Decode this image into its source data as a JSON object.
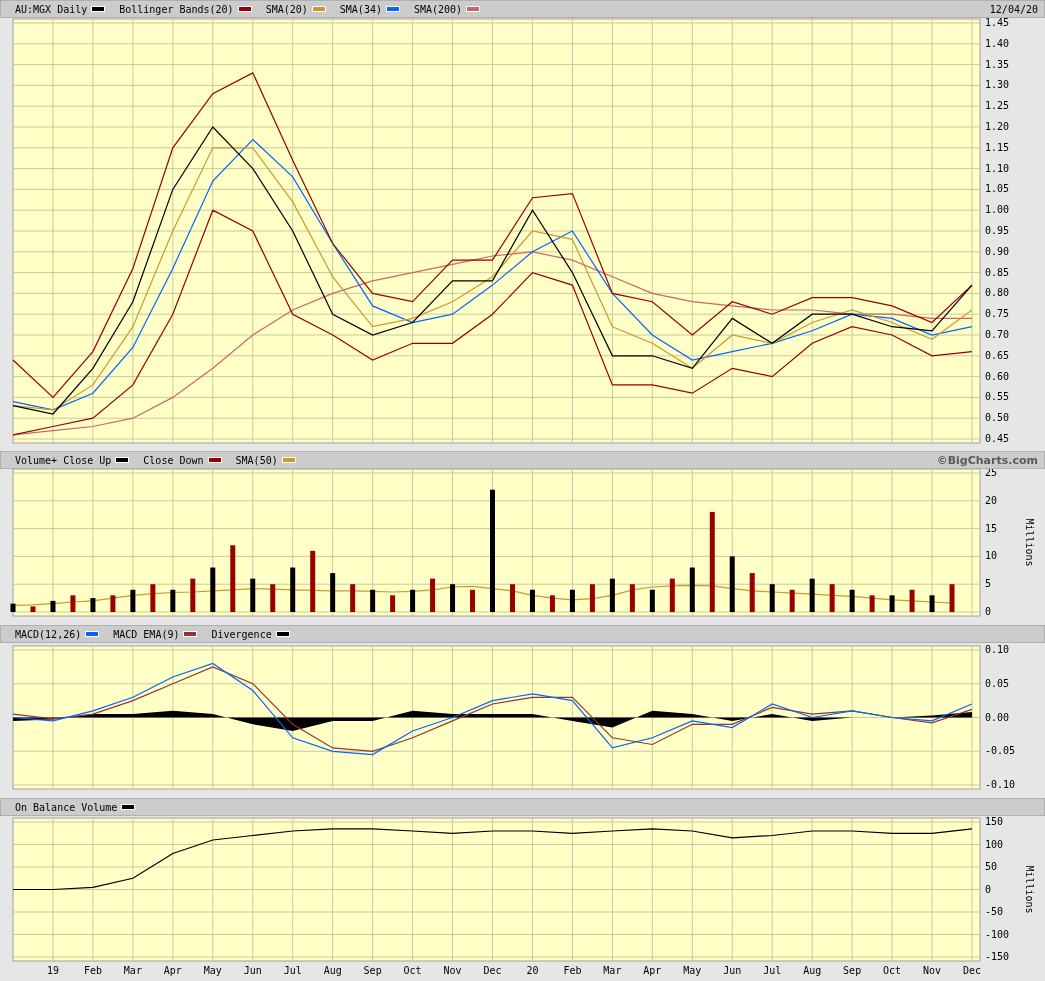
{
  "date": "12/04/20",
  "price_panel": {
    "chart_data": {
      "type": "line",
      "grid": true,
      "categories": [
        null,
        null,
        null,
        null,
        null,
        null,
        null,
        null,
        null,
        null,
        null,
        null,
        null,
        null,
        null,
        null,
        null,
        null,
        null,
        null,
        null,
        null,
        null,
        null,
        null
      ],
      "ylim": [
        0.45,
        1.45
      ],
      "yticks": [
        {
          "value": 0.45,
          "label": "0.45"
        },
        {
          "value": 0.5,
          "label": "0.50"
        },
        {
          "value": 0.55,
          "label": "0.55"
        },
        {
          "value": 0.6,
          "label": "0.60"
        },
        {
          "value": 0.65,
          "label": "0.65"
        },
        {
          "value": 0.7,
          "label": "0.70"
        },
        {
          "value": 0.75,
          "label": "0.75"
        },
        {
          "value": 0.8,
          "label": "0.80"
        },
        {
          "value": 0.85,
          "label": "0.85"
        },
        {
          "value": 0.9,
          "label": "0.90"
        },
        {
          "value": 0.95,
          "label": "0.95"
        },
        {
          "value": 1.0,
          "label": "1.00"
        },
        {
          "value": 1.05,
          "label": "1.05"
        },
        {
          "value": 1.1,
          "label": "1.10"
        },
        {
          "value": 1.15,
          "label": "1.15"
        },
        {
          "value": 1.2,
          "label": "1.20"
        },
        {
          "value": 1.25,
          "label": "1.25"
        },
        {
          "value": 1.3,
          "label": "1.30"
        },
        {
          "value": 1.35,
          "label": "1.35"
        },
        {
          "value": 1.4,
          "label": "1.40"
        },
        {
          "value": 1.45,
          "label": "1.45"
        }
      ],
      "series": [
        {
          "name": "AU:MGX Daily",
          "color": "#000000",
          "values": [
            0.53,
            0.51,
            0.62,
            0.78,
            1.05,
            1.2,
            1.1,
            0.95,
            0.75,
            0.7,
            0.73,
            0.83,
            0.83,
            1.0,
            0.85,
            0.65,
            0.65,
            0.62,
            0.74,
            0.68,
            0.75,
            0.75,
            0.72,
            0.71,
            0.82
          ]
        },
        {
          "name": "Bollinger Bands(20)",
          "color": "#990000",
          "values": [
            0.64,
            0.55,
            0.66,
            0.86,
            1.15,
            1.28,
            1.33,
            1.12,
            0.92,
            0.8,
            0.78,
            0.88,
            0.88,
            1.03,
            1.04,
            0.8,
            0.78,
            0.7,
            0.78,
            0.75,
            0.79,
            0.79,
            0.77,
            0.73,
            0.82
          ]
        },
        {
          "color": "#990000",
          "values": [
            0.46,
            0.48,
            0.5,
            0.58,
            0.75,
            1.0,
            0.95,
            0.75,
            0.7,
            0.64,
            0.68,
            0.68,
            0.75,
            0.85,
            0.82,
            0.58,
            0.58,
            0.56,
            0.62,
            0.6,
            0.68,
            0.72,
            0.7,
            0.65,
            0.66
          ]
        },
        {
          "name": "SMA(20)",
          "color": "#cc9933",
          "values": [
            0.53,
            0.52,
            0.58,
            0.72,
            0.95,
            1.15,
            1.15,
            1.02,
            0.84,
            0.72,
            0.74,
            0.78,
            0.84,
            0.95,
            0.93,
            0.72,
            0.68,
            0.62,
            0.7,
            0.68,
            0.73,
            0.76,
            0.73,
            0.69,
            0.76
          ]
        },
        {
          "name": "SMA(34)",
          "color": "#0066ff",
          "values": [
            0.54,
            0.52,
            0.56,
            0.67,
            0.86,
            1.07,
            1.17,
            1.08,
            0.92,
            0.77,
            0.73,
            0.75,
            0.82,
            0.9,
            0.95,
            0.8,
            0.7,
            0.64,
            0.66,
            0.68,
            0.71,
            0.75,
            0.74,
            0.7,
            0.72
          ]
        },
        {
          "name": "SMA(200)",
          "color": "#cc6666",
          "values": [
            0.46,
            0.47,
            0.48,
            0.5,
            0.55,
            0.62,
            0.7,
            0.76,
            0.8,
            0.83,
            0.85,
            0.87,
            0.89,
            0.9,
            0.88,
            0.84,
            0.8,
            0.78,
            0.77,
            0.76,
            0.76,
            0.75,
            0.75,
            0.74,
            0.74
          ]
        }
      ]
    }
  },
  "volume_panel": {
    "credit": "©BigCharts.com",
    "chart_data": {
      "type": "bar",
      "stacked": true,
      "grid": true,
      "categories": [
        null,
        null,
        null,
        null,
        null,
        null,
        null,
        null,
        null,
        null,
        null,
        null,
        null,
        null,
        null,
        null,
        null,
        null,
        null,
        null,
        null,
        null,
        null,
        null,
        null,
        null,
        null,
        null,
        null,
        null,
        null,
        null,
        null,
        null,
        null,
        null,
        null,
        null,
        null,
        null,
        null,
        null,
        null,
        null,
        null,
        null,
        null,
        null
      ],
      "ylim": [
        0,
        25
      ],
      "ylabel": "Millions",
      "yticks": [
        0,
        5,
        10,
        15,
        20,
        25
      ],
      "series": [
        {
          "name": "Volume+ Close Up",
          "color": "#000000",
          "values": [
            1.5,
            null,
            2,
            null,
            2.5,
            null,
            4,
            null,
            4,
            null,
            8,
            null,
            6,
            null,
            8,
            null,
            7,
            null,
            4,
            null,
            4,
            null,
            5,
            null,
            22,
            null,
            4,
            null,
            4,
            null,
            6,
            null,
            4,
            null,
            8,
            null,
            10,
            null,
            5,
            null,
            6,
            null,
            4,
            null,
            3,
            null,
            3,
            null
          ]
        },
        {
          "name": "Close Down",
          "color": "#990000",
          "values": [
            null,
            1,
            null,
            3,
            null,
            3,
            null,
            5,
            null,
            6,
            null,
            12,
            null,
            5,
            null,
            11,
            null,
            5,
            null,
            3,
            null,
            6,
            null,
            4,
            null,
            5,
            null,
            3,
            null,
            5,
            null,
            5,
            null,
            6,
            null,
            18,
            null,
            7,
            null,
            4,
            null,
            5,
            null,
            3,
            null,
            4,
            null,
            5
          ]
        },
        {
          "name": "SMA(50)",
          "color": "#cc9933",
          "type": "line",
          "values": [
            1.2,
            1.3,
            1.5,
            1.8,
            2,
            2.5,
            3,
            3.3,
            3.5,
            3.6,
            3.8,
            4,
            4.2,
            4.1,
            4,
            3.9,
            3.8,
            3.8,
            3.7,
            3.6,
            3.7,
            4,
            4.5,
            4.6,
            4.2,
            3.8,
            3,
            2.5,
            2.2,
            2.4,
            3,
            4,
            4.5,
            4.7,
            4.8,
            4.7,
            4.2,
            3.8,
            3.6,
            3.4,
            3.2,
            3,
            2.8,
            2.5,
            2.2,
            2,
            1.8,
            1.6
          ]
        }
      ]
    }
  },
  "macd_panel": {
    "chart_data": {
      "type": "line",
      "grid": true,
      "categories": [
        null,
        null,
        null,
        null,
        null,
        null,
        null,
        null,
        null,
        null,
        null,
        null,
        null,
        null,
        null,
        null,
        null,
        null,
        null,
        null,
        null,
        null,
        null,
        null,
        null
      ],
      "ylim": [
        -0.1,
        0.1
      ],
      "yticks": [
        {
          "value": -0.1,
          "label": "-0.10"
        },
        {
          "value": -0.05,
          "label": "-0.05"
        },
        {
          "value": 0,
          "label": "0.00"
        },
        {
          "value": 0.05,
          "label": "0.05"
        },
        {
          "value": 0.1,
          "label": "0.10"
        }
      ],
      "series": [
        {
          "name": "MACD(12,26)",
          "color": "#0066ff",
          "values": [
            0,
            -0.005,
            0.01,
            0.03,
            0.06,
            0.08,
            0.04,
            -0.03,
            -0.05,
            -0.055,
            -0.02,
            0,
            0.025,
            0.035,
            0.025,
            -0.045,
            -0.03,
            -0.005,
            -0.015,
            0.02,
            0,
            0.01,
            0,
            -0.005,
            0.02
          ]
        },
        {
          "name": "MACD EMA(9)",
          "color": "#993333",
          "values": [
            0.005,
            -0.002,
            0.005,
            0.025,
            0.05,
            0.075,
            0.05,
            -0.01,
            -0.045,
            -0.05,
            -0.03,
            -0.005,
            0.02,
            0.03,
            0.03,
            -0.03,
            -0.04,
            -0.01,
            -0.01,
            0.015,
            0.005,
            0.01,
            0,
            -0.008,
            0.012
          ]
        },
        {
          "name": "Divergence",
          "color": "#000000",
          "type": "area",
          "values": [
            -0.005,
            -0.003,
            0.005,
            0.005,
            0.01,
            0.005,
            -0.01,
            -0.02,
            -0.005,
            -0.005,
            0.01,
            0.005,
            0.005,
            0.005,
            -0.005,
            -0.015,
            0.01,
            0.005,
            -0.005,
            0.005,
            -0.005,
            0,
            0,
            0.003,
            0.008
          ]
        }
      ]
    }
  },
  "obv_panel": {
    "chart_data": {
      "type": "line",
      "grid": true,
      "categories": [
        null,
        "19",
        "Feb",
        "Mar",
        "Apr",
        "May",
        "Jun",
        "Jul",
        "Aug",
        "Sep",
        "Oct",
        "Nov",
        "Dec",
        "20",
        "Feb",
        "Mar",
        "Apr",
        "May",
        "Jun",
        "Jul",
        "Aug",
        "Sep",
        "Oct",
        "Nov",
        "Dec"
      ],
      "ylim": [
        -150,
        150
      ],
      "ylabel": "Millions",
      "yticks": [
        -150,
        -100,
        -50,
        0,
        50,
        100,
        150
      ],
      "series": [
        {
          "name": "On Balance Volume",
          "color": "#000000",
          "values": [
            0,
            0,
            5,
            25,
            80,
            110,
            120,
            130,
            135,
            135,
            130,
            125,
            130,
            130,
            125,
            130,
            135,
            130,
            115,
            120,
            130,
            130,
            125,
            125,
            135
          ]
        }
      ]
    }
  }
}
